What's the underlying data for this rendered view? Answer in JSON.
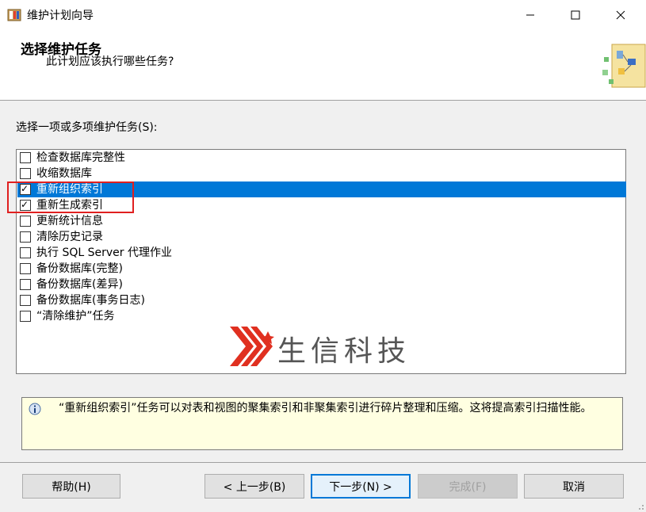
{
  "window": {
    "title": "维护计划向导",
    "minimize_icon": "minimize-icon",
    "maximize_icon": "maximize-icon",
    "close_icon": "close-icon"
  },
  "header": {
    "title": "选择维护任务",
    "subtitle": "此计划应该执行哪些任务?"
  },
  "prompt": "选择一项或多项维护任务(S):",
  "tasks": [
    {
      "label": "检查数据库完整性",
      "checked": false,
      "selected": false
    },
    {
      "label": "收缩数据库",
      "checked": false,
      "selected": false
    },
    {
      "label": "重新组织索引",
      "checked": true,
      "selected": true
    },
    {
      "label": "重新生成索引",
      "checked": true,
      "selected": false
    },
    {
      "label": "更新统计信息",
      "checked": false,
      "selected": false
    },
    {
      "label": "清除历史记录",
      "checked": false,
      "selected": false
    },
    {
      "label": "执行 SQL Server 代理作业",
      "checked": false,
      "selected": false
    },
    {
      "label": "备份数据库(完整)",
      "checked": false,
      "selected": false
    },
    {
      "label": "备份数据库(差异)",
      "checked": false,
      "selected": false
    },
    {
      "label": "备份数据库(事务日志)",
      "checked": false,
      "selected": false
    },
    {
      "label": "“清除维护”任务",
      "checked": false,
      "selected": false
    }
  ],
  "watermark": "生信科技",
  "info": "“重新组织索引”任务可以对表和视图的聚集索引和非聚集索引进行碎片整理和压缩。这将提高索引扫描性能。",
  "buttons": {
    "help": "帮助(H)",
    "back": "< 上一步(B)",
    "next": "下一步(N) >",
    "finish": "完成(F)",
    "cancel": "取消"
  },
  "colors": {
    "selection": "#0078d7",
    "highlight_box": "#e02020",
    "info_bg": "#ffffe1",
    "watermark_red": "#e03020"
  }
}
